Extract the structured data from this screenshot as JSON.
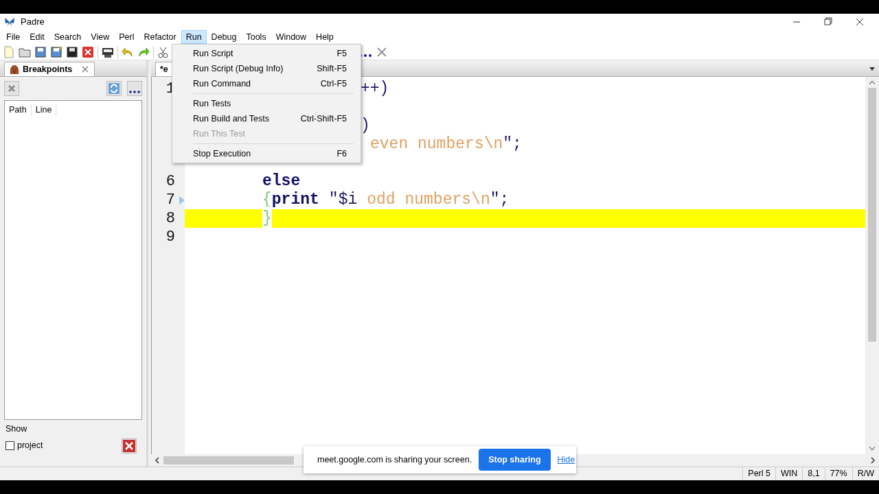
{
  "window": {
    "title": "Padre"
  },
  "menu_bar": [
    {
      "label": "File",
      "selected": false
    },
    {
      "label": "Edit",
      "selected": false
    },
    {
      "label": "Search",
      "selected": false
    },
    {
      "label": "View",
      "selected": false
    },
    {
      "label": "Perl",
      "selected": false
    },
    {
      "label": "Refactor",
      "selected": false
    },
    {
      "label": "Run",
      "selected": true
    },
    {
      "label": "Debug",
      "selected": false
    },
    {
      "label": "Tools",
      "selected": false
    },
    {
      "label": "Window",
      "selected": false
    },
    {
      "label": "Help",
      "selected": false
    }
  ],
  "run_menu": [
    {
      "kind": "item",
      "label": "Run Script",
      "shortcut": "F5",
      "disabled": false
    },
    {
      "kind": "item",
      "label": "Run Script (Debug Info)",
      "shortcut": "Shift-F5",
      "disabled": false
    },
    {
      "kind": "item",
      "label": "Run Command",
      "shortcut": "Ctrl-F5",
      "disabled": false
    },
    {
      "kind": "separator"
    },
    {
      "kind": "item",
      "label": "Run Tests",
      "disabled": false
    },
    {
      "kind": "item",
      "label": "Run Build and Tests",
      "shortcut": "Ctrl-Shift-F5",
      "disabled": false
    },
    {
      "kind": "item",
      "label": "Run This Test",
      "disabled": true
    },
    {
      "kind": "separator"
    },
    {
      "kind": "item",
      "label": "Stop Execution",
      "shortcut": "F6",
      "disabled": false
    }
  ],
  "left_panel": {
    "tab": "Breakpoints",
    "columns": [
      "Path",
      "Line"
    ],
    "show_label": "Show",
    "checkbox": {
      "label": "project",
      "checked": false
    }
  },
  "editor": {
    "tab": "*e",
    "lines": [
      {
        "number": "1",
        "highlighted": false,
        "marker": false,
        "partly_covered": true,
        "segments": [
          {
            "kind": "plain",
            "text": "++)",
            "spaced": false
          }
        ]
      },
      {
        "highlighted": false,
        "marker": false
      },
      {
        "highlighted": false,
        "marker": false,
        "partly_covered": true,
        "segments": [
          {
            "kind": "plain",
            "text": ")",
            "spaced": false
          }
        ]
      },
      {
        "highlighted": false,
        "marker": false,
        "partly_covered": true,
        "segments": [
          {
            "kind": "string",
            "text": "even numbers\\n",
            "spaced": true
          },
          {
            "kind": "plain",
            "text": "\";",
            "spaced": false
          }
        ]
      },
      {
        "highlighted": false,
        "marker": false
      },
      {
        "number": "6",
        "highlighted": false,
        "marker": false,
        "indented": true,
        "segments": [
          {
            "kind": "keyword",
            "text": "else",
            "spaced": false
          }
        ]
      },
      {
        "number": "7",
        "highlighted": false,
        "marker": true,
        "indented": true,
        "segments": [
          {
            "kind": "brace",
            "text": "{",
            "spaced": false
          },
          {
            "kind": "keyword",
            "text": "print",
            "spaced": false
          },
          {
            "kind": "plain",
            "text": "\"$i",
            "spaced": true
          },
          {
            "kind": "string",
            "text": "odd numbers\\n",
            "spaced": true
          },
          {
            "kind": "plain",
            "text": "\";",
            "spaced": false
          }
        ]
      },
      {
        "number": "8",
        "highlighted": true,
        "marker": false,
        "indented": true,
        "segments": [
          {
            "kind": "brace",
            "text": "}",
            "spaced": false
          }
        ]
      },
      {
        "number": "9",
        "highlighted": false,
        "marker": false
      }
    ]
  },
  "share_bar": {
    "message": "meet.google.com is sharing your screen.",
    "stop_button": "Stop sharing",
    "hide_link": "Hide"
  },
  "status_bar": [
    "Perl 5",
    "WIN",
    "8,1",
    "77%",
    "R/W"
  ]
}
